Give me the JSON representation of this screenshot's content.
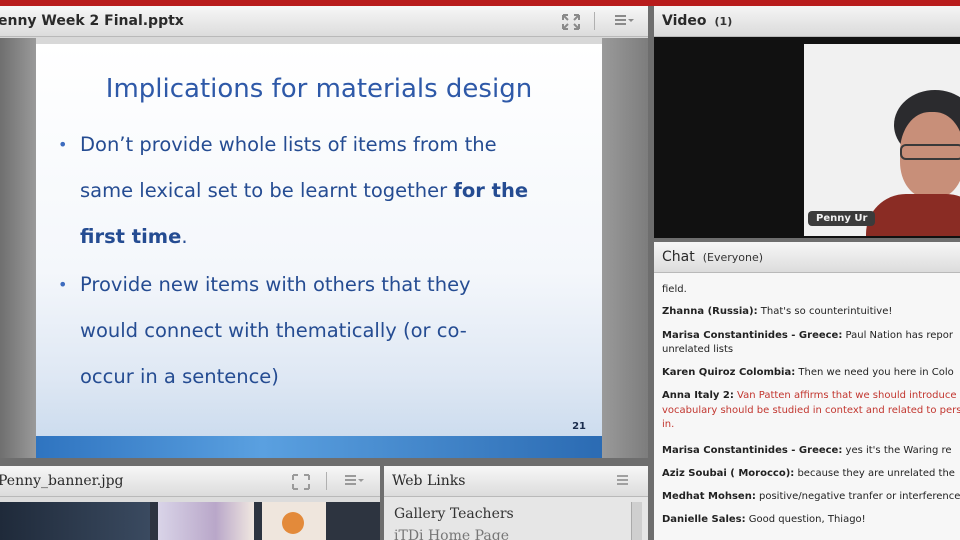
{
  "share_pod": {
    "title": "enny Week 2 Final.pptx",
    "slide": {
      "title": "Implications for materials design",
      "bullet1": {
        "line1": "Don’t provide whole lists of items from the",
        "line2a": "same lexical set to be learnt together ",
        "line2b": "for the",
        "line3a": "first time",
        "line3b": "."
      },
      "bullet2": {
        "line1": "Provide new items with others that they",
        "line2": "would connect with thematically (or co-",
        "line3": "occur in a sentence)"
      },
      "page_number": "21"
    }
  },
  "banner_pod": {
    "title": "Penny_banner.jpg"
  },
  "links_pod": {
    "title": "Web Links",
    "items": [
      "Gallery Teachers",
      "iTDi Home Page"
    ]
  },
  "video_pod": {
    "title": "Video",
    "count": "(1)",
    "presenter_name": "Penny Ur"
  },
  "chat_pod": {
    "title": "Chat",
    "audience": "(Everyone)",
    "messages": [
      {
        "sender": "",
        "text": "field."
      },
      {
        "sender": "Zhanna (Russia):",
        "text": " That's so counterintuitive!"
      },
      {
        "sender": "Marisa Constantinides - Greece:",
        "text": " Paul Nation has repor"
      },
      {
        "sender": "",
        "text": "unrelated lists"
      },
      {
        "sender": "Karen Quiroz Colombia:",
        "text": " Then we need you here in Colo"
      },
      {
        "sender": "Anna Italy 2:",
        "text": " Van Patten affirms that we should introduce"
      },
      {
        "sender": "",
        "text": "vocabulary should be studied in context and related to pers"
      },
      {
        "sender": "",
        "text": "in."
      },
      {
        "sender": "Marisa Constantinides - Greece:",
        "text": " yes it's the Waring re"
      },
      {
        "sender": "Aziz Soubai ( Morocco):",
        "text": " because they are unrelated the"
      },
      {
        "sender": "Medhat Mohsen:",
        "text": " positive/negative tranfer or interference"
      },
      {
        "sender": "Danielle Sales:",
        "text": " Good question, Thiago!"
      }
    ]
  },
  "colors": {
    "slide_title": "#2e59a8",
    "slide_text": "#254c92",
    "chat_highlight": "#c2362f",
    "top_bar": "#b81c1c"
  },
  "icons": [
    "fullscreen-icon",
    "pod-menu-icon"
  ]
}
